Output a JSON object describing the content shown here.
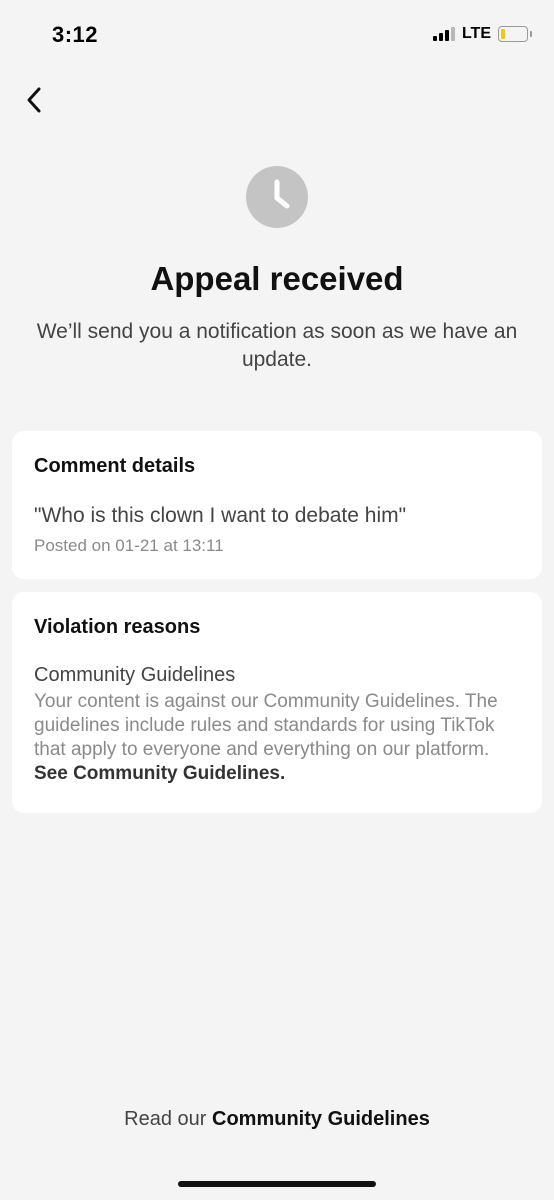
{
  "status_bar": {
    "time": "3:12",
    "network": "LTE",
    "battery_color": "#f5c518"
  },
  "nav": {
    "back_icon": "chevron-left-icon"
  },
  "header": {
    "icon": "clock-icon",
    "title": "Appeal received",
    "subtitle": "We’ll send you a notification as soon as we have an update."
  },
  "comment_card": {
    "title": "Comment details",
    "comment": "\"Who is this clown I want to debate him\"",
    "posted": "Posted on 01-21 at 13:11"
  },
  "violation_card": {
    "title": "Violation reasons",
    "reason": "Community Guidelines",
    "description": "Your content is against our Community Guidelines. The guidelines include rules and standards for using TikTok that apply to everyone and everything on our platform.",
    "link": "See Community Guidelines."
  },
  "footer": {
    "prefix": "Read our",
    "link": "Community Guidelines"
  }
}
